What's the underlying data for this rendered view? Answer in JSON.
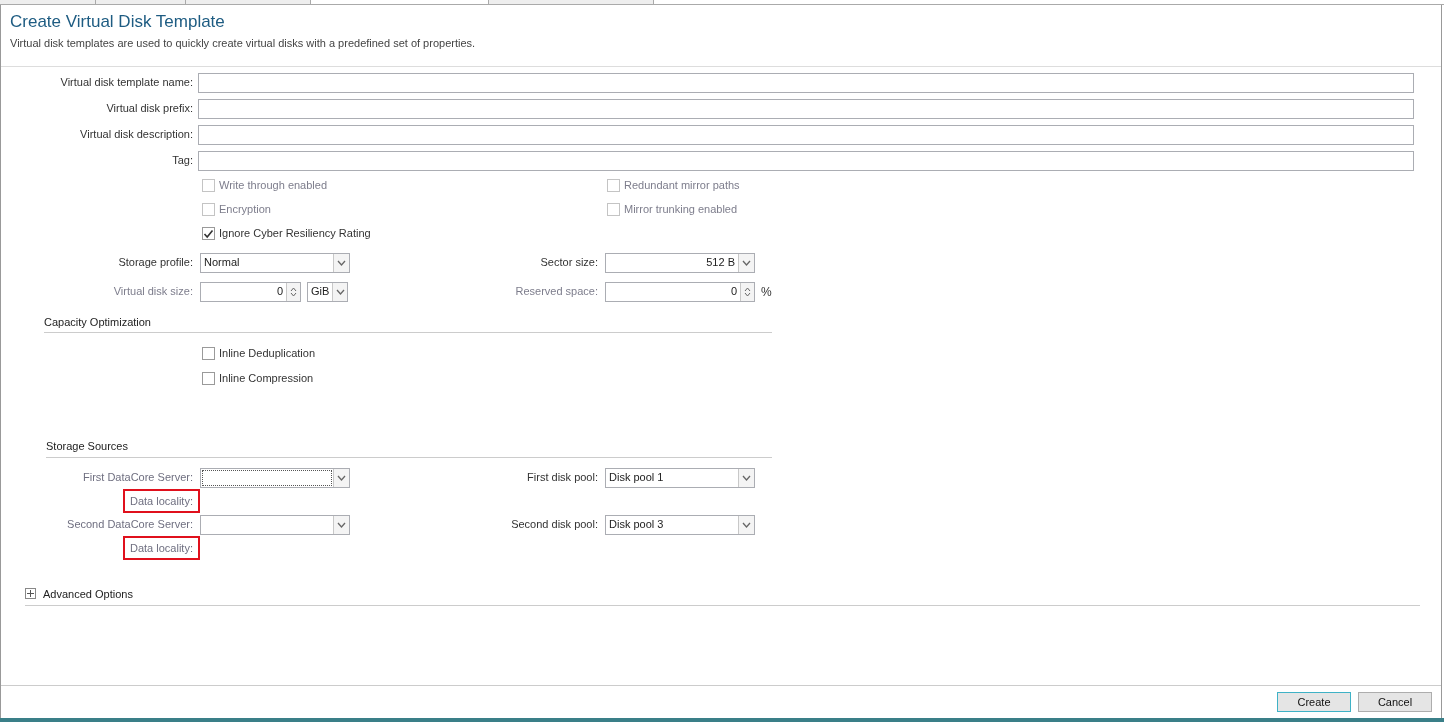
{
  "tabs": [
    {
      "selected": false
    },
    {
      "selected": false
    },
    {
      "selected": false
    },
    {
      "selected": true
    },
    {
      "selected": false
    }
  ],
  "header": {
    "title": "Create Virtual Disk Template",
    "subtitle": "Virtual disk templates are used to quickly create virtual disks with a predefined set of properties."
  },
  "fields": [
    {
      "label": "Virtual disk template name:"
    },
    {
      "label": "Virtual disk prefix:"
    },
    {
      "label": "Virtual disk description:"
    },
    {
      "label": "Tag:"
    }
  ],
  "options_left": [
    {
      "label": "Write through enabled",
      "checked": false,
      "disabled": true
    },
    {
      "label": "Encryption",
      "checked": false,
      "disabled": true
    },
    {
      "label": "Ignore Cyber Resiliency Rating",
      "checked": true,
      "disabled": false
    }
  ],
  "options_right": [
    {
      "label": "Redundant mirror paths",
      "checked": false,
      "disabled": true
    },
    {
      "label": "Mirror trunking enabled",
      "checked": false,
      "disabled": true
    }
  ],
  "settings": [
    {
      "left": {
        "kind": "dropdown",
        "label": "Storage profile:",
        "value": "Normal",
        "disabled": false
      },
      "right": {
        "kind": "dropdown",
        "label": "Sector size:",
        "value": "512 B",
        "disabled": false
      }
    },
    {
      "left": {
        "kind": "spinner",
        "label": "Virtual disk size:",
        "value": "0",
        "unit": "GiB",
        "disabled": true
      },
      "right": {
        "kind": "spinner",
        "label": "Reserved space:",
        "value": "0",
        "suffix": "%",
        "disabled": true
      }
    }
  ],
  "capacity_optimization": {
    "title": "Capacity Optimization",
    "options": [
      {
        "label": "Inline Deduplication",
        "checked": false
      },
      {
        "label": "Inline Compression",
        "checked": false
      }
    ]
  },
  "storage_sources": {
    "title": "Storage Sources",
    "rows": [
      {
        "server_label": "First DataCore Server:",
        "server_focused": true,
        "locality_label": "Data locality:",
        "locality_highlighted": true,
        "pool_label": "First disk pool:",
        "pool_value": "Disk pool 1"
      },
      {
        "server_label": "Second DataCore Server:",
        "server_focused": false,
        "locality_label": "Data locality:",
        "locality_highlighted": true,
        "pool_label": "Second disk pool:",
        "pool_value": "Disk pool 3"
      }
    ]
  },
  "advanced": {
    "label": "Advanced Options",
    "expanded": false
  },
  "buttons": [
    {
      "label": "Create",
      "default": true
    },
    {
      "label": "Cancel",
      "default": false
    }
  ]
}
